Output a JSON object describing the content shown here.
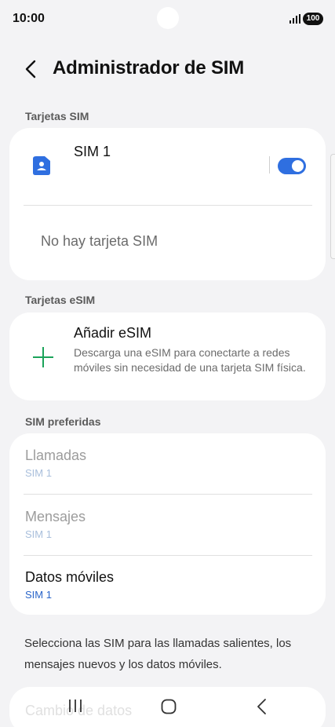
{
  "status_bar": {
    "time": "10:00",
    "battery": "100"
  },
  "header": {
    "title": "Administrador de SIM"
  },
  "sections": {
    "sim_cards": {
      "label": "Tarjetas SIM",
      "sim1": {
        "name": "SIM 1",
        "enabled": true
      },
      "empty_text": "No hay tarjeta SIM"
    },
    "esim_cards": {
      "label": "Tarjetas eSIM",
      "add_title": "Añadir eSIM",
      "add_description": "Descarga una eSIM para conectarte a redes móviles sin necesidad de una tarjeta SIM física."
    },
    "preferred": {
      "label": "SIM preferidas",
      "items": [
        {
          "title": "Llamadas",
          "value": "SIM 1"
        },
        {
          "title": "Mensajes",
          "value": "SIM 1"
        },
        {
          "title": "Datos móviles",
          "value": "SIM 1"
        }
      ]
    }
  },
  "footnote": "Selecciona las SIM para las llamadas salientes, los mensajes nuevos y los datos móviles.",
  "bottom_item": "Cambio de datos",
  "colors": {
    "accent": "#2f6fe0",
    "plus": "#1ba35a",
    "sim_icon": "#2f6fe0",
    "background": "#f3f3f5"
  },
  "icons": {
    "back": "back-arrow-icon",
    "sim": "sim-card-icon",
    "plus": "plus-icon"
  }
}
